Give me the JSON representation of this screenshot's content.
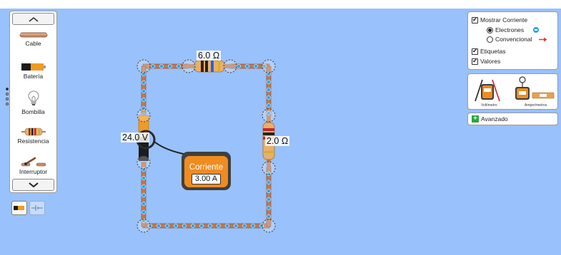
{
  "toolbox": {
    "items": [
      {
        "label": "Cable",
        "icon": "wire-icon"
      },
      {
        "label": "Batería",
        "icon": "battery-icon"
      },
      {
        "label": "Bombilla",
        "icon": "lightbulb-icon"
      },
      {
        "label": "Resistencia",
        "icon": "resistor-icon"
      },
      {
        "label": "Interruptor",
        "icon": "switch-icon"
      }
    ],
    "page_dots": [
      true,
      false,
      false,
      false
    ]
  },
  "view_options": {
    "show_current_label": "Mostrar Corriente",
    "show_current_checked": true,
    "electrons_label": "Electrones",
    "electrons_selected": true,
    "conventional_label": "Convencional",
    "conventional_selected": false,
    "labels_label": "Etiquetas",
    "labels_checked": true,
    "values_label": "Valores",
    "values_checked": true
  },
  "meters": {
    "voltmeter_label": "Voltímetro",
    "ammeter_label": "Amperímetros"
  },
  "advanced": {
    "label": "Avanzado"
  },
  "circuit": {
    "top_resistor_label": "6.0 Ω",
    "right_resistor_label": "2.0 Ω",
    "battery_label": "24.0 V",
    "ammeter_title": "Corriente",
    "ammeter_value": "3.00 A"
  },
  "colors": {
    "background": "#99c1fb",
    "wire": "#b87b5a",
    "electron": "#2aa3e8",
    "ammeter_orange": "#f08b1f",
    "resistor_body": "#e8b06a"
  }
}
